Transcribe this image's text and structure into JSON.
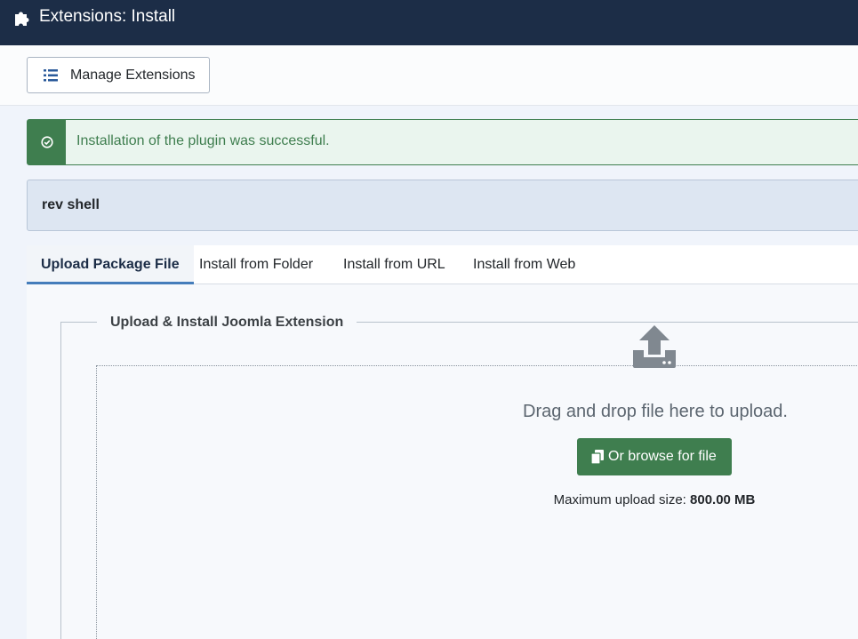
{
  "header": {
    "title": "Extensions: Install",
    "icon": "puzzle-icon",
    "background": "#1c2d47"
  },
  "toolbar": {
    "manage_label": "Manage Extensions",
    "manage_icon": "list-icon"
  },
  "alert": {
    "type": "success",
    "icon": "check-circle-icon",
    "message": "Installation of the plugin was successful.",
    "color": "#3f7e4f"
  },
  "plugin_message": {
    "text": "rev shell"
  },
  "tabs": [
    {
      "label": "Upload Package File",
      "active": true
    },
    {
      "label": "Install from Folder",
      "active": false
    },
    {
      "label": "Install from URL",
      "active": false
    },
    {
      "label": "Install from Web",
      "active": false
    }
  ],
  "upload": {
    "legend": "Upload & Install Joomla Extension",
    "icon": "upload-icon",
    "drag_text": "Drag and drop file here to upload.",
    "browse_label": "Or browse for file",
    "browse_icon": "copy-icon",
    "max_size_label": "Maximum upload size: ",
    "max_size_value": "800.00 MB"
  }
}
